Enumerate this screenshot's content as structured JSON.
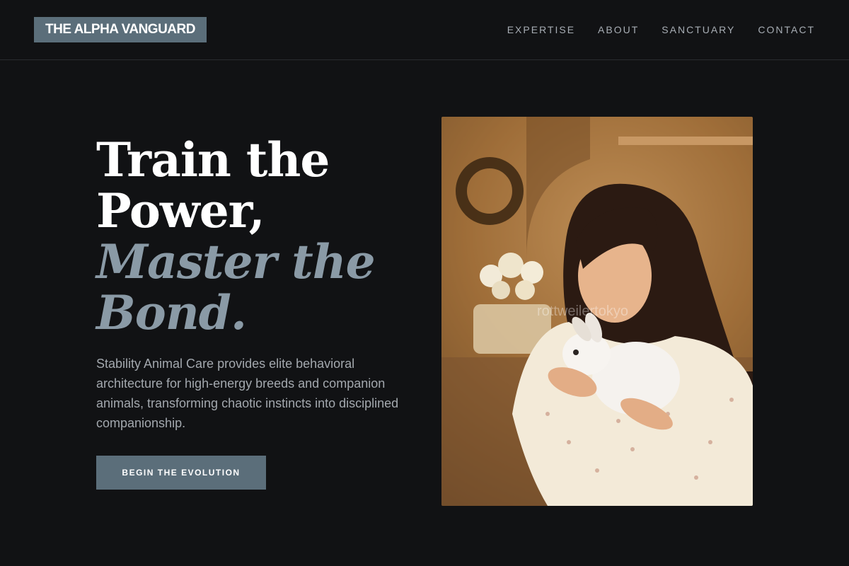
{
  "header": {
    "logo": "THE ALPHA VANGUARD",
    "nav": [
      "EXPERTISE",
      "ABOUT",
      "SANCTUARY",
      "CONTACT"
    ]
  },
  "hero": {
    "headline_line1": "Train the",
    "headline_line2": "Power,",
    "headline_accent1": "Master the",
    "headline_accent2": "Bond.",
    "description": "Stability Animal Care provides elite behavioral architecture for high-energy breeds and companion animals, transforming chaotic instincts into disciplined companionship.",
    "cta_label": "BEGIN THE EVOLUTION",
    "photo_watermark": "rottweilertokyo"
  },
  "colors": {
    "background": "#111214",
    "accent": "#5b6e7a",
    "headline_accent": "#8a9aa6",
    "body_text": "#a3a8ae"
  }
}
